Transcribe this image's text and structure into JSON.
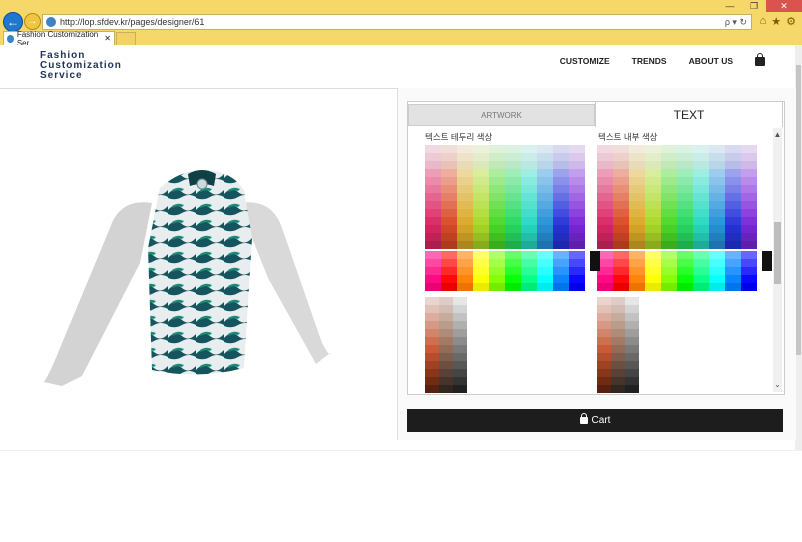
{
  "browser": {
    "url": "http://lop.sfdev.kr/pages/designer/61",
    "tab_title": "Fashion Customization Ser...",
    "tab_close": "✕",
    "window_buttons": [
      "—",
      "❐",
      "✕"
    ],
    "address_icons": "ρ ▾ ↻",
    "toolbar_icons": [
      "home-icon",
      "star-icon",
      "gear-icon"
    ]
  },
  "header": {
    "logo_line1": "Fashion",
    "logo_line2": "Customization",
    "logo_line3": "Service",
    "menu": [
      "CUSTOMIZE",
      "TRENDS",
      "ABOUT US"
    ]
  },
  "panel": {
    "tab_artwork": "ARTWORK",
    "tab_text": "TEXT",
    "active_tab": "TEXT",
    "label_border_color": "텍스트 테두리 색상",
    "label_inner_color": "텍스트 내부 색상",
    "cart_label": "Cart"
  },
  "colors": {
    "brand_navy": "#1e3355",
    "browser_chrome": "#f6d76a",
    "cart_button": "#1d1d1d"
  }
}
